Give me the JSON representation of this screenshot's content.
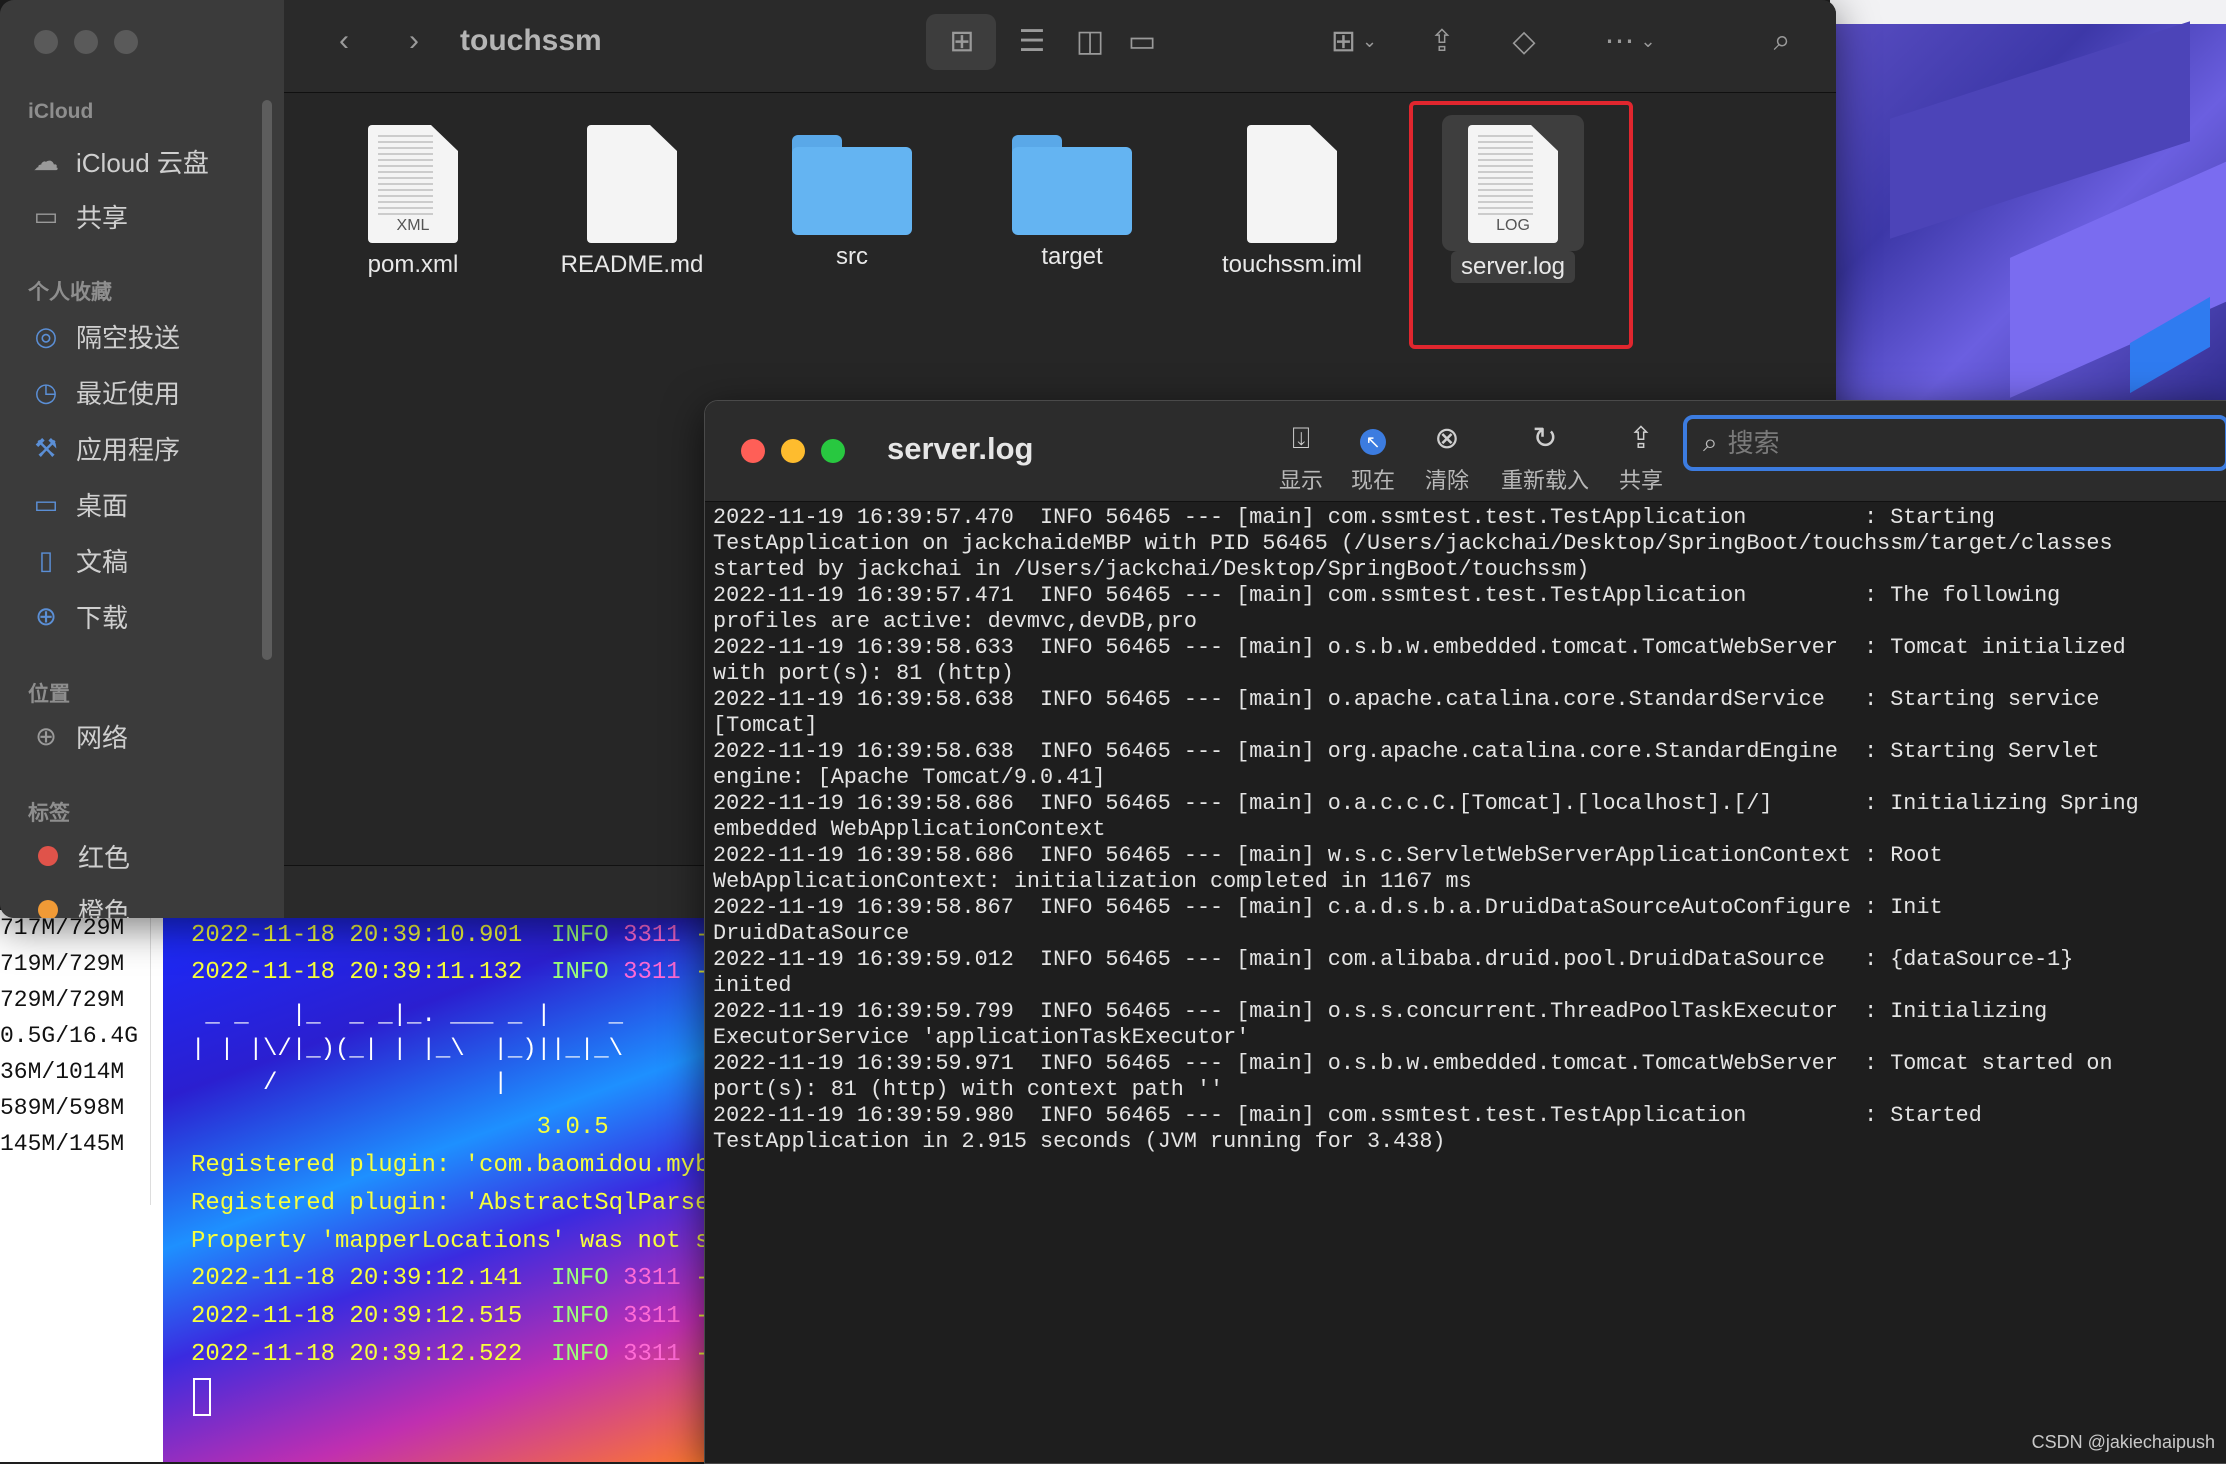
{
  "finder": {
    "title": "touchssm",
    "sidebar": {
      "sections": [
        "iCloud",
        "个人收藏",
        "位置",
        "标签"
      ],
      "icloud_items": [
        "iCloud 云盘",
        "共享"
      ],
      "favorites": [
        "隔空投送",
        "最近使用",
        "应用程序",
        "桌面",
        "文稿",
        "下载"
      ],
      "locations": [
        "网络"
      ],
      "tags": [
        {
          "label": "红色",
          "color": "#e0534a"
        },
        {
          "label": "橙色",
          "color": "#f09a36"
        }
      ]
    },
    "files": [
      {
        "name": "pom.xml",
        "kind": "xml-file-icon",
        "tag": "XML"
      },
      {
        "name": "README.md",
        "kind": "document-icon",
        "tag": ""
      },
      {
        "name": "src",
        "kind": "folder-icon",
        "tag": ""
      },
      {
        "name": "target",
        "kind": "folder-icon",
        "tag": ""
      },
      {
        "name": "touchssm.iml",
        "kind": "document-icon",
        "tag": ""
      },
      {
        "name": "server.log",
        "kind": "log-file-icon",
        "tag": "LOG",
        "selected": true
      }
    ]
  },
  "terminal": {
    "memory": [
      "717M/729M",
      "719M/729M",
      "729M/729M",
      "0.5G/16.4G",
      "36M/1014M",
      "589M/598M",
      "145M/145M"
    ],
    "lines": {
      "l1": {
        "date": "2022-11-18 20:39:10.901",
        "level": "INFO",
        "pid": "3311",
        "rest": "--"
      },
      "l2": {
        "date": "2022-11-18 20:39:11.132",
        "level": "INFO",
        "pid": "3311",
        "rest": "--"
      },
      "banner1": " _ _   |_  _ _|_. ___ _ |    _",
      "banner2": "| | |\\/|_)(_| | |_\\  |_)||_|_\\",
      "banner3": "     /               |",
      "version": "                        3.0.5",
      "p1": "Registered plugin: 'com.baomidou.myba",
      "p2": "Registered plugin: 'AbstractSqlParser",
      "p3": "Property 'mapperLocations' was not sp",
      "l3": {
        "date": "2022-11-18 20:39:12.141",
        "level": "INFO",
        "pid": "3311",
        "rest": "--"
      },
      "l4": {
        "date": "2022-11-18 20:39:12.515",
        "level": "INFO",
        "pid": "3311",
        "rest": "--"
      },
      "l5": {
        "date": "2022-11-18 20:39:12.522",
        "level": "INFO",
        "pid": "3311",
        "rest": "--"
      }
    }
  },
  "console": {
    "title": "server.log",
    "toolbar": {
      "show": "显示",
      "now": "现在",
      "clear": "清除",
      "reload": "重新载入",
      "share": "共享"
    },
    "search_placeholder": "搜索",
    "log_lines": [
      "2022-11-19 16:39:57.470  INFO 56465 --- [main] com.ssmtest.test.TestApplication         : Starting",
      "TestApplication on jackchaideMBP with PID 56465 (/Users/jackchai/Desktop/SpringBoot/touchssm/target/classes",
      "started by jackchai in /Users/jackchai/Desktop/SpringBoot/touchssm)",
      "2022-11-19 16:39:57.471  INFO 56465 --- [main] com.ssmtest.test.TestApplication         : The following",
      "profiles are active: devmvc,devDB,pro",
      "2022-11-19 16:39:58.633  INFO 56465 --- [main] o.s.b.w.embedded.tomcat.TomcatWebServer  : Tomcat initialized",
      "with port(s): 81 (http)",
      "2022-11-19 16:39:58.638  INFO 56465 --- [main] o.apache.catalina.core.StandardService   : Starting service",
      "[Tomcat]",
      "2022-11-19 16:39:58.638  INFO 56465 --- [main] org.apache.catalina.core.StandardEngine  : Starting Servlet",
      "engine: [Apache Tomcat/9.0.41]",
      "2022-11-19 16:39:58.686  INFO 56465 --- [main] o.a.c.c.C.[Tomcat].[localhost].[/]       : Initializing Spring",
      "embedded WebApplicationContext",
      "2022-11-19 16:39:58.686  INFO 56465 --- [main] w.s.c.ServletWebServerApplicationContext : Root",
      "WebApplicationContext: initialization completed in 1167 ms",
      "2022-11-19 16:39:58.867  INFO 56465 --- [main] c.a.d.s.b.a.DruidDataSourceAutoConfigure : Init",
      "DruidDataSource",
      "2022-11-19 16:39:59.012  INFO 56465 --- [main] com.alibaba.druid.pool.DruidDataSource   : {dataSource-1}",
      "inited",
      "2022-11-19 16:39:59.799  INFO 56465 --- [main] o.s.s.concurrent.ThreadPoolTaskExecutor  : Initializing",
      "ExecutorService 'applicationTaskExecutor'",
      "2022-11-19 16:39:59.971  INFO 56465 --- [main] o.s.b.w.embedded.tomcat.TomcatWebServer  : Tomcat started on",
      "port(s): 81 (http) with context path ''",
      "2022-11-19 16:39:59.980  INFO 56465 --- [main] com.ssmtest.test.TestApplication         : Started",
      "TestApplication in 2.915 seconds (JVM running for 3.438)"
    ]
  },
  "watermark": "CSDN @jakiechaipush",
  "colors": {
    "selection_outline": "#e0262e",
    "search_focus": "#3c7ce0",
    "close": "#ff5f57",
    "minimize": "#febc2e",
    "zoom": "#28c840"
  }
}
